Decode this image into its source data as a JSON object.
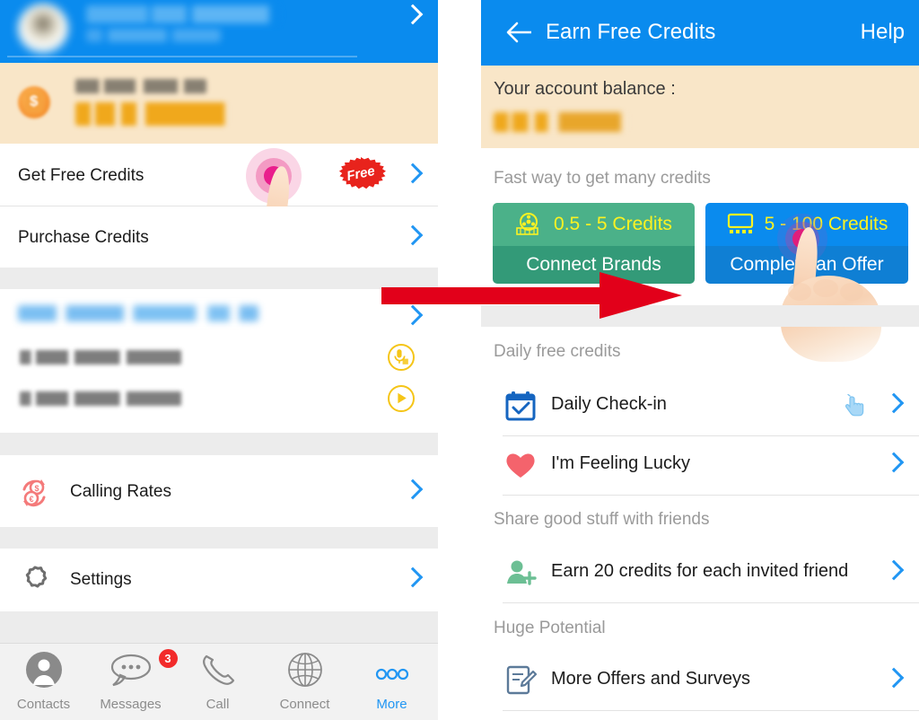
{
  "left_panel": {
    "header": {
      "name_redacted": "",
      "subtitle_redacted": "",
      "chevron_icon": "chevron-right-icon"
    },
    "balance": {
      "label_redacted": "Account Balance",
      "amount_redacted": "77.20 Credits",
      "coin_icon": "coin-dollar-icon"
    },
    "rows": [
      {
        "label": "Get Free Credits",
        "badge": "Free",
        "chevron": "chevron-right-icon"
      },
      {
        "label": "Purchase Credits",
        "badge": "",
        "chevron": "chevron-right-icon"
      }
    ],
    "contact": {
      "name_redacted": "Forward / Hide / Number / #",
      "phone1_redacted": "+1 (415) 790-6886",
      "phone2_redacted": "+1 (405) 489-2143",
      "voicemail_icon": "microphone-record-icon",
      "play_icon": "play-circle-icon",
      "chevron": "chevron-right-icon"
    },
    "menu": [
      {
        "label": "Calling Rates",
        "icon": "currency-exchange-icon",
        "chevron": "chevron-right-icon"
      },
      {
        "label": "Settings",
        "icon": "gear-icon",
        "chevron": "chevron-right-icon"
      }
    ],
    "tabbar": [
      {
        "label": "Contacts",
        "icon": "person-icon",
        "badge": "",
        "active": false
      },
      {
        "label": "Messages",
        "icon": "chat-bubble-icon",
        "badge": "3",
        "active": false
      },
      {
        "label": "Call",
        "icon": "phone-handset-icon",
        "badge": "",
        "active": false
      },
      {
        "label": "Connect",
        "icon": "globe-icon",
        "badge": "",
        "active": false
      },
      {
        "label": "More",
        "icon": "three-dots-icon",
        "badge": "",
        "active": true
      }
    ]
  },
  "right_panel": {
    "appbar": {
      "back_icon": "arrow-left-icon",
      "title": "Earn Free Credits",
      "help_label": "Help"
    },
    "balance": {
      "label": "Your account balance :",
      "amount_redacted": "77.20 Credits"
    },
    "fast_section": {
      "title": "Fast way to get many credits",
      "buttons": [
        {
          "amount": "0.5 - 5 Credits",
          "action": "Connect Brands",
          "icon": "film-reel-icon",
          "color": "#4bb189"
        },
        {
          "amount": "5 - 100 Credits",
          "action": "Complete an Offer",
          "icon": "tv-monitor-icon",
          "color": "#0a8bee"
        }
      ]
    },
    "daily_section": {
      "title": "Daily free credits",
      "rows": [
        {
          "label": "Daily Check-in",
          "icon": "calendar-check-icon",
          "hint_icon": "pointing-hand-cursor-icon",
          "chevron": "chevron-right-icon"
        },
        {
          "label": "I'm Feeling Lucky",
          "icon": "heart-icon",
          "hint_icon": "",
          "chevron": "chevron-right-icon"
        }
      ]
    },
    "share_section": {
      "title": "Share good stuff with friends",
      "rows": [
        {
          "label": "Earn 20 credits for each invited friend",
          "icon": "add-person-icon",
          "chevron": "chevron-right-icon"
        }
      ]
    },
    "potential_section": {
      "title": "Huge Potential",
      "rows": [
        {
          "label": "More Offers and Surveys",
          "icon": "survey-edit-icon",
          "chevron": "chevron-right-icon"
        }
      ]
    }
  },
  "annotations": {
    "arrow_icon": "red-right-arrow-annotation",
    "tap_indicator_left": "tap-ripple-indicator",
    "tap_indicator_right": "tap-ripple-indicator"
  },
  "colors": {
    "brand_blue": "#0a8bee",
    "balance_bg": "#f9e6c8",
    "green_button": "#4bb189",
    "accent_yellow": "#fbf222",
    "annotation_red": "#e2001a",
    "badge_red": "#f22b2b"
  }
}
